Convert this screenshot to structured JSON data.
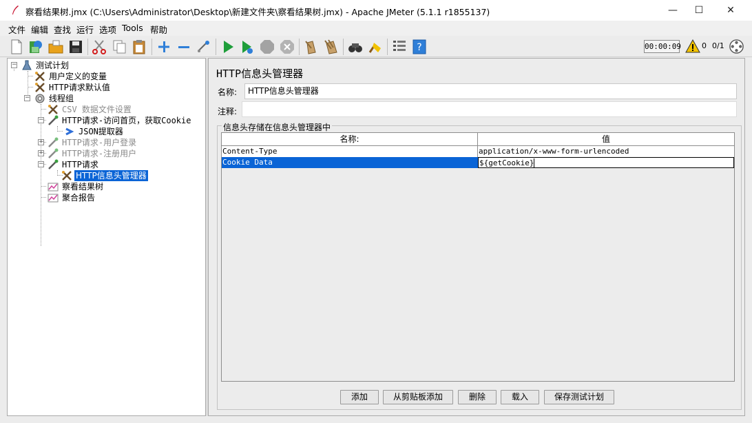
{
  "window": {
    "title": "察看结果树.jmx (C:\\Users\\Administrator\\Desktop\\新建文件夹\\察看结果树.jmx) - Apache JMeter (5.1.1 r1855137)",
    "minimize": "—",
    "maximize": "☐",
    "close": "✕"
  },
  "menu": [
    "文件",
    "编辑",
    "查找",
    "运行",
    "选项",
    "Tools",
    "帮助"
  ],
  "toolbar": {
    "icons": [
      "new-icon",
      "templates-icon",
      "open-icon",
      "save-icon",
      "cut-icon",
      "copy-icon",
      "paste-icon",
      "expand-icon",
      "collapse-icon",
      "toggle-icon",
      "start-icon",
      "start-no-pause-icon",
      "stop-icon",
      "shutdown-icon",
      "clear-icon",
      "clear-all-icon",
      "search-icon",
      "reset-search-icon",
      "function-helper-icon",
      "help-icon"
    ],
    "timer": "00:00:09",
    "warning_count": "0",
    "thread_count": "0/1",
    "colors": {
      "start": "#1e9e3a",
      "stop": "#9a9a9a",
      "add": "#2f7fd8",
      "warning": "#f2c200"
    }
  },
  "tree": {
    "nodes": [
      {
        "label": "测试计划",
        "icon": "test-plan-icon"
      },
      {
        "label": "用户定义的变量",
        "icon": "config-element-icon"
      },
      {
        "label": "HTTP请求默认值",
        "icon": "config-element-icon"
      },
      {
        "label": "线程组",
        "icon": "thread-group-icon"
      },
      {
        "label": "CSV 数据文件设置",
        "icon": "config-element-icon"
      },
      {
        "label": "HTTP请求-访问首页，获取Cookie",
        "icon": "sampler-icon"
      },
      {
        "label": "JSON提取器",
        "icon": "post-processor-icon"
      },
      {
        "label": "HTTP请求-用户登录",
        "icon": "sampler-icon"
      },
      {
        "label": "HTTP请求-注册用户",
        "icon": "sampler-icon"
      },
      {
        "label": "HTTP请求",
        "icon": "sampler-icon"
      },
      {
        "label": "HTTP信息头管理器",
        "icon": "config-element-icon"
      },
      {
        "label": "察看结果树",
        "icon": "listener-icon"
      },
      {
        "label": "聚合报告",
        "icon": "listener-icon"
      }
    ]
  },
  "panel": {
    "title": "HTTP信息头管理器",
    "name_label": "名称:",
    "name_value": "HTTP信息头管理器",
    "comment_label": "注释:",
    "comment_value": "",
    "group_title": "信息头存储在信息头管理器中",
    "table": {
      "headers": [
        "名称:",
        "值"
      ],
      "rows": [
        {
          "name": "Content-Type",
          "value": "application/x-www-form-urlencoded"
        },
        {
          "name": "Cookie Data",
          "value": "${getCookie}"
        }
      ]
    },
    "buttons": [
      "添加",
      "从剪贴板添加",
      "删除",
      "载入",
      "保存测试计划"
    ]
  }
}
